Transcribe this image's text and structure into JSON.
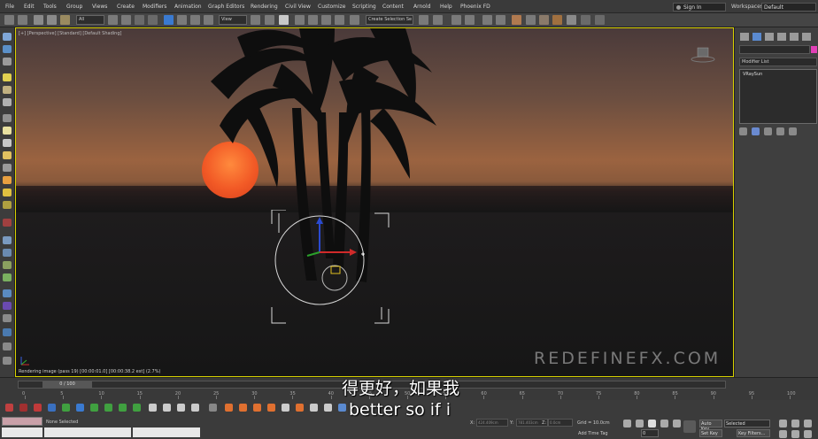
{
  "menu": [
    "File",
    "Edit",
    "Tools",
    "Group",
    "Views",
    "Create",
    "Modifiers",
    "Animation",
    "Graph Editors",
    "Rendering",
    "Civil View",
    "Customize",
    "Scripting",
    "Content",
    "Arnold",
    "Help",
    "Phoenix FD"
  ],
  "account": {
    "sign_in": "Sign In",
    "workspaces_label": "Workspaces:",
    "workspace_value": "Default"
  },
  "toolbar": {
    "filter": "All",
    "view": "View",
    "selection_set": "Create Selection Se"
  },
  "viewport": {
    "label": "[+] [Perspective] [Standard] [Default Shading]",
    "render_status": "Rendering image (pass 19) [00:00:01.0] [00:00:38.2 est]    (2.7%)",
    "watermark": "REDEFINEFX.COM"
  },
  "command_panel": {
    "modifier_list": "Modifier List",
    "stack_item": "VRaySun",
    "color": "#e23fb6"
  },
  "timeline": {
    "time_display": "0 / 100",
    "ticks": [
      "0",
      "5",
      "10",
      "15",
      "20",
      "25",
      "30",
      "35",
      "40",
      "45",
      "50",
      "55",
      "60",
      "65",
      "70",
      "75",
      "80",
      "85",
      "90",
      "95",
      "100"
    ]
  },
  "status": {
    "selection": "None Selected",
    "x_label": "X:",
    "y_label": "Y:",
    "z_label": "Z:",
    "x_value": "424.409cm",
    "y_value": "781.403cm",
    "z_value": "0.0cm",
    "grid": "Grid = 10.0cm",
    "add_time_tag": "Add Time Tag",
    "auto_key": "Auto Key",
    "set_key": "Set Key",
    "selected": "Selected",
    "key_filters": "Key Filters...",
    "frame": "0"
  },
  "subtitles": {
    "chinese": "得更好，如果我",
    "english": "better so if i"
  }
}
